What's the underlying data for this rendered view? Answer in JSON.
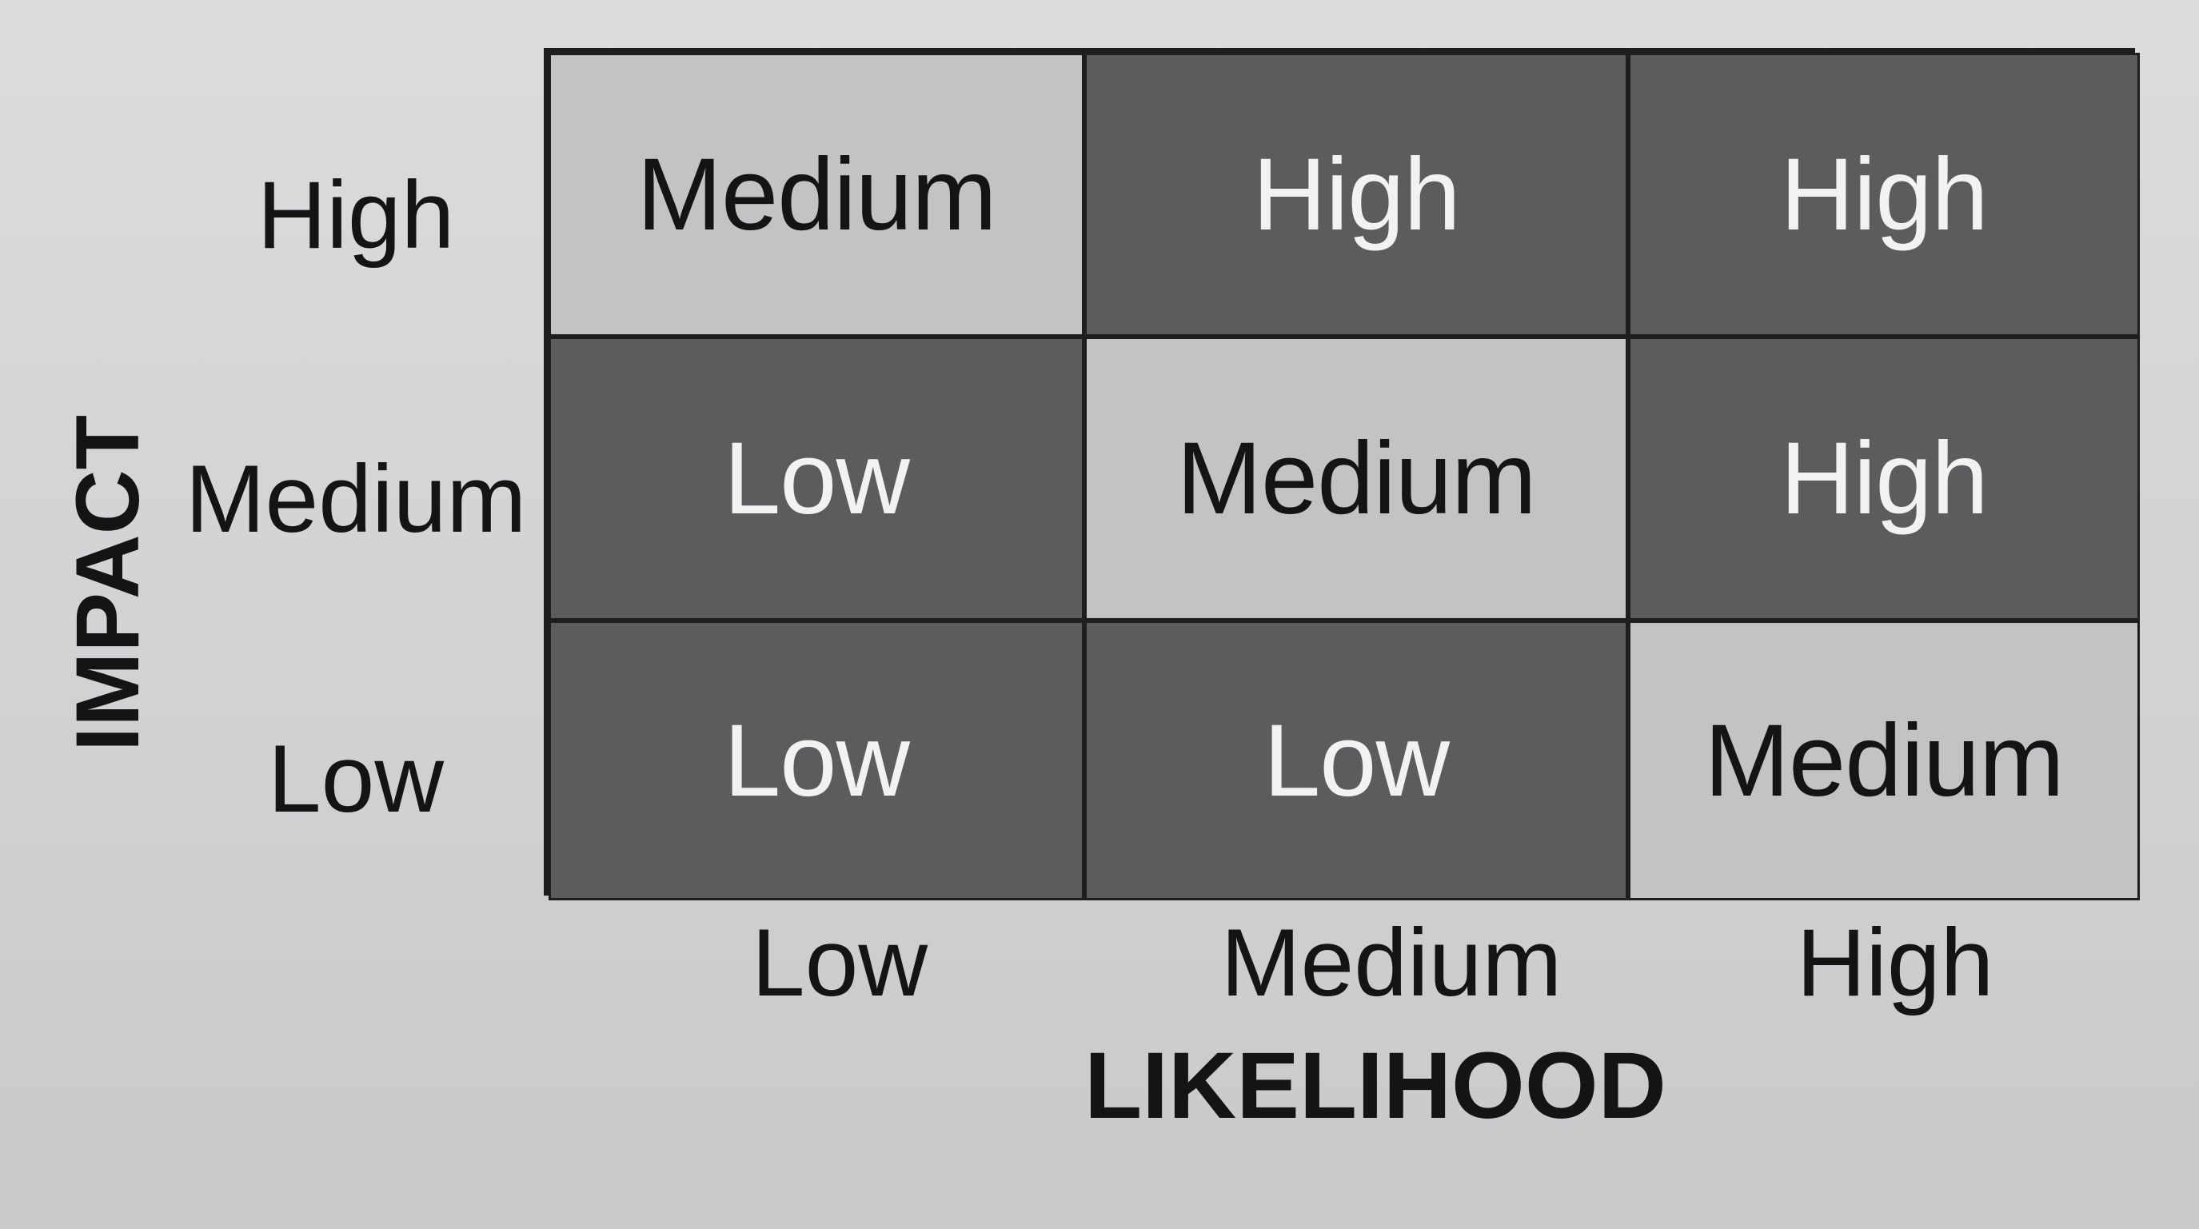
{
  "axes": {
    "y_title": "IMPACT",
    "x_title": "LIKELIHOOD",
    "row_labels": [
      "High",
      "Medium",
      "Low"
    ],
    "col_labels": [
      "Low",
      "Medium",
      "High"
    ]
  },
  "grid": {
    "rows": [
      [
        {
          "label": "Medium",
          "shade": "light"
        },
        {
          "label": "High",
          "shade": "dark"
        },
        {
          "label": "High",
          "shade": "dark"
        }
      ],
      [
        {
          "label": "Low",
          "shade": "dark"
        },
        {
          "label": "Medium",
          "shade": "light"
        },
        {
          "label": "High",
          "shade": "dark"
        }
      ],
      [
        {
          "label": "Low",
          "shade": "dark"
        },
        {
          "label": "Low",
          "shade": "dark"
        },
        {
          "label": "Medium",
          "shade": "light"
        }
      ]
    ]
  },
  "colors": {
    "dark_cell": "#5c5c5e",
    "light_cell": "#c3c3c5",
    "border": "#1e1e1e"
  }
}
